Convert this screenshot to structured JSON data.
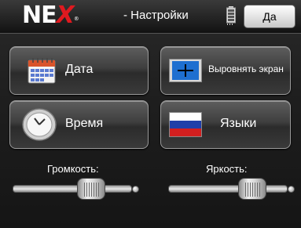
{
  "header": {
    "logo_main": "NE",
    "logo_x": "X",
    "logo_reg": "®",
    "title": "- Настройки",
    "yes_label": "Да"
  },
  "buttons": {
    "date_label": "Дата",
    "align_label": "Выровнять экран",
    "time_label": "Время",
    "language_label": "Языки"
  },
  "sliders": {
    "volume_label": "Громкость:",
    "volume_level": 0.72,
    "brightness_label": "Яркость:",
    "brightness_level": 0.78
  },
  "icons": {
    "calendar": "calendar-icon",
    "align": "crosshair-icon",
    "clock": "clock-icon",
    "flag": "russian-flag-icon",
    "battery": "battery-icon"
  },
  "colors": {
    "logo_accent": "#e0191f",
    "flag_white": "#ffffff",
    "flag_blue": "#1f3fa8",
    "flag_red": "#d21f1f"
  }
}
